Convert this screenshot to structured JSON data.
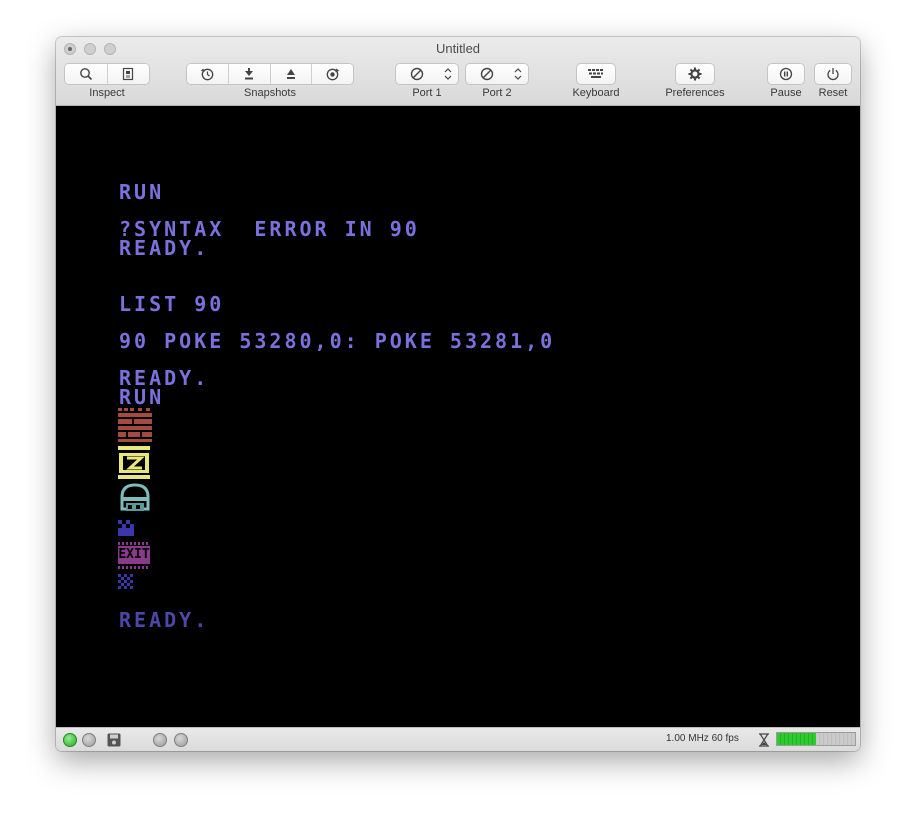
{
  "window": {
    "title": "Untitled"
  },
  "toolbar": {
    "inspect_label": "Inspect",
    "snapshots_label": "Snapshots",
    "port1_label": "Port 1",
    "port2_label": "Port 2",
    "keyboard_label": "Keyboard",
    "preferences_label": "Preferences",
    "pause_label": "Pause",
    "reset_label": "Reset"
  },
  "screen": {
    "text_color": "#7b71dd",
    "lines": {
      "run1": "RUN",
      "syntax_error": "?SYNTAX  ERROR IN 90",
      "ready1": "READY.",
      "list_cmd": "LIST 90",
      "program_line": "90 POKE 53280,0: POKE 53281,0",
      "ready2": "READY.",
      "run2": "RUN",
      "exit_text": "EXIT",
      "ready3": "READY."
    }
  },
  "statusbar": {
    "speed_text": "1.00 MHz 60 fps",
    "meter_level": 0.5
  }
}
